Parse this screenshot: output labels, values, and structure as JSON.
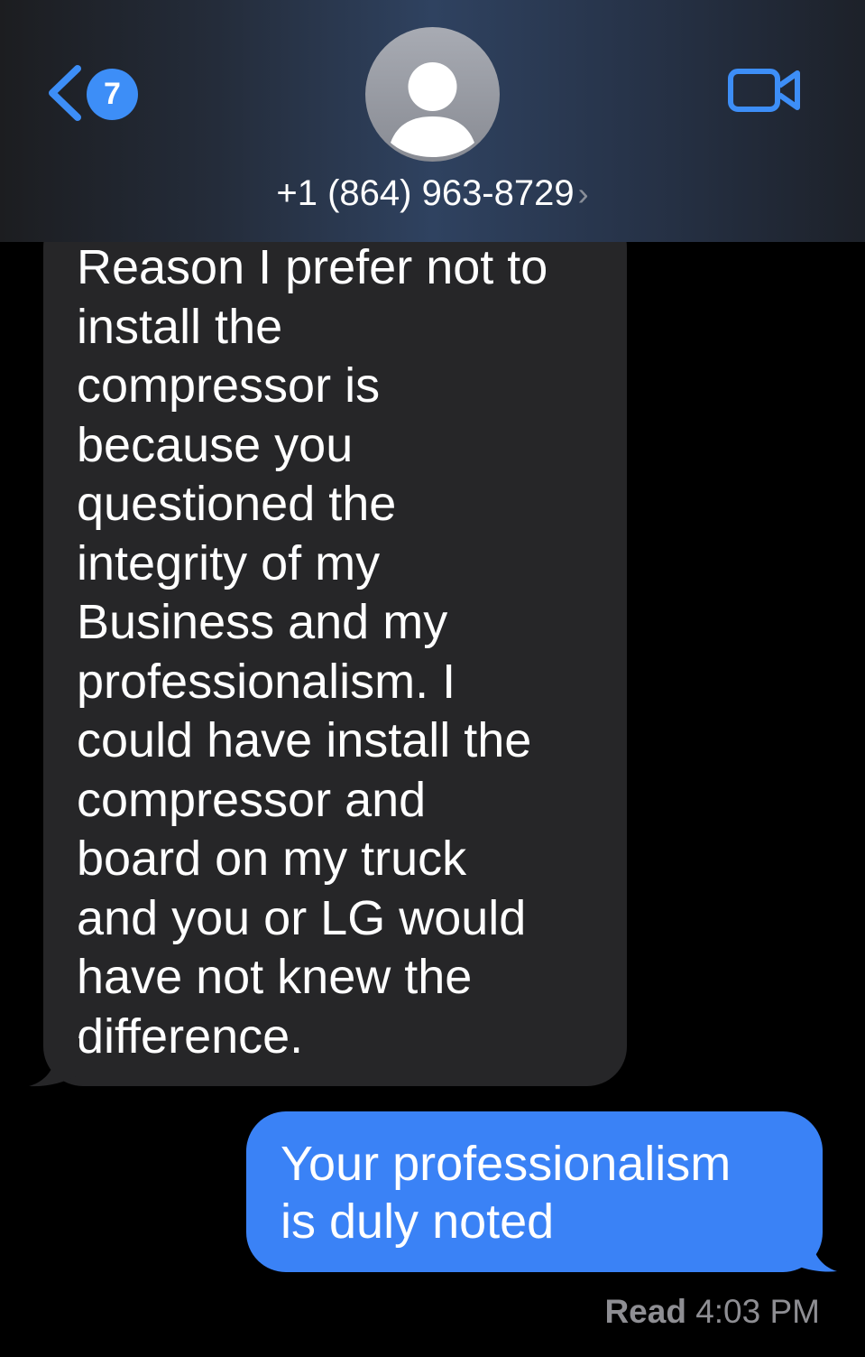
{
  "header": {
    "back_badge_count": "7",
    "contact_name": "+1 (864) 963-8729",
    "chevron": "›",
    "icons": {
      "back": "chevron-left-icon",
      "avatar": "person-icon",
      "video": "video-camera-icon"
    }
  },
  "messages": [
    {
      "direction": "incoming",
      "text": "Reason I prefer not to\ninstall the\ncompressor is\nbecause you\nquestioned the\nintegrity of my\nBusiness and my\nprofessionalism. I\ncould have install the\ncompressor and\nboard on my truck\nand you or LG would\nhave not knew the\ndifference."
    },
    {
      "direction": "outgoing",
      "text": "Your professionalism\nis duly noted"
    }
  ],
  "receipt": {
    "status": "Read",
    "time": "4:03 PM"
  },
  "colors": {
    "accent": "#3d8ef7",
    "incoming_bubble": "#262628",
    "outgoing_bubble": "#3a82f6",
    "background": "#000000"
  }
}
